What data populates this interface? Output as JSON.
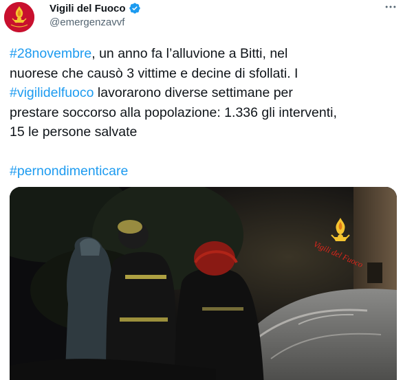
{
  "account": {
    "display_name": "Vigili del Fuoco",
    "handle": "@emergenzavvf",
    "verified": true,
    "avatar_icon": "vigili-del-fuoco-logo",
    "avatar_bg": "#c8102e"
  },
  "tweet": {
    "line1": {
      "hashtag": "#28novembre",
      "rest": ", un anno fa l’alluvione a Bitti, nel"
    },
    "line2": "nuorese che causò 3 vittime e decine di sfollati. I",
    "line3": {
      "hashtag": "#vigilidelfuoco",
      "rest": " lavorarono diverse settimane per"
    },
    "line4": "prestare soccorso alla popolazione: 1.336 gli interventi,",
    "line5": "15 le persone salvate",
    "line6": {
      "hashtag": "#pernondimenticare"
    }
  },
  "media": {
    "watermark_text": "Vigili del Fuoco",
    "watermark_icon": "vigili-del-fuoco-emblem"
  },
  "colors": {
    "link": "#1d9bf0",
    "text": "#0f1419",
    "secondary": "#536471"
  },
  "icons": {
    "verified": "verified-badge-icon",
    "more": "more-options-icon"
  }
}
